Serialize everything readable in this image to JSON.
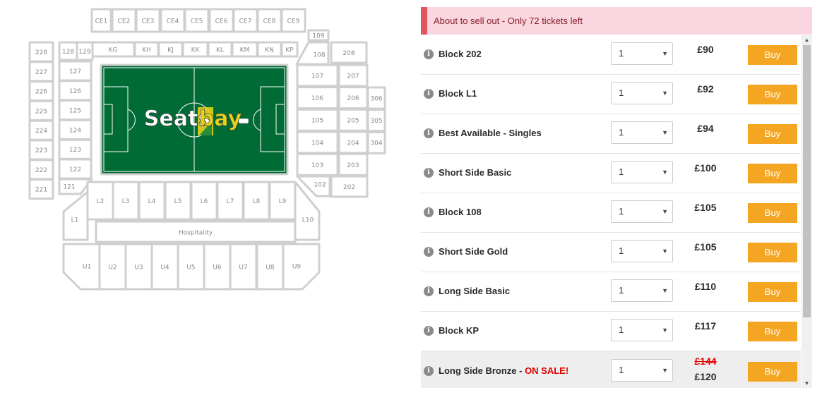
{
  "map": {
    "ce_blocks": [
      "CE1",
      "CE2",
      "CE3",
      "CE4",
      "CE5",
      "CE6",
      "CE7",
      "CE8",
      "CE9"
    ],
    "k_blocks": [
      "KG",
      "KH",
      "KJ",
      "KK",
      "KL",
      "KM",
      "KN",
      "KP"
    ],
    "left_blocks_outer": [
      "228",
      "227",
      "226",
      "225",
      "224",
      "223",
      "222",
      "221"
    ],
    "left_blocks_inner": [
      "127",
      "126",
      "125",
      "124",
      "123",
      "122"
    ],
    "corner_blocks": [
      "128",
      "129",
      "121",
      "109",
      "108",
      "208",
      "102",
      "202"
    ],
    "right_blocks_inner": [
      "107",
      "106",
      "105",
      "104",
      "103"
    ],
    "right_blocks_mid": [
      "207",
      "206",
      "205",
      "204",
      "203"
    ],
    "right_blocks_outer": [
      "306",
      "305",
      "304"
    ],
    "l_blocks": [
      "L2",
      "L3",
      "L4",
      "L5",
      "L6",
      "L7",
      "L8",
      "L9"
    ],
    "l_end_blocks": [
      "L1",
      "L10"
    ],
    "hospitality_label": "Hospitality",
    "u_blocks": [
      "U1",
      "U2",
      "U3",
      "U4",
      "U5",
      "U6",
      "U7",
      "U8",
      "U9"
    ],
    "logo_text_a": "Seats",
    "logo_text_b": "bay",
    "pitch_color": "#006b35",
    "logo_accent_color": "#e8d21a"
  },
  "alert": {
    "text": "About to sell out - Only 72 tickets left",
    "color": "#e05560"
  },
  "tickets": [
    {
      "name": "Block 202",
      "qty": "1",
      "price": "£90",
      "buy_label": "Buy"
    },
    {
      "name": "Block L1",
      "qty": "1",
      "price": "£92",
      "buy_label": "Buy"
    },
    {
      "name": "Best Available - Singles",
      "qty": "1",
      "price": "£94",
      "buy_label": "Buy"
    },
    {
      "name": "Short Side Basic",
      "qty": "1",
      "price": "£100",
      "buy_label": "Buy"
    },
    {
      "name": "Block 108",
      "qty": "1",
      "price": "£105",
      "buy_label": "Buy"
    },
    {
      "name": "Short Side Gold",
      "qty": "1",
      "price": "£105",
      "buy_label": "Buy"
    },
    {
      "name": "Long Side Basic",
      "qty": "1",
      "price": "£110",
      "buy_label": "Buy"
    },
    {
      "name": "Block KP",
      "qty": "1",
      "price": "£117",
      "buy_label": "Buy"
    },
    {
      "name": "Long Side Bronze - ",
      "sale_tag": "ON SALE!",
      "qty": "1",
      "old_price": "£144",
      "price": "£120",
      "buy_label": "Buy"
    }
  ],
  "colors": {
    "buy_button": "#f4a623",
    "sale": "#e00000"
  }
}
